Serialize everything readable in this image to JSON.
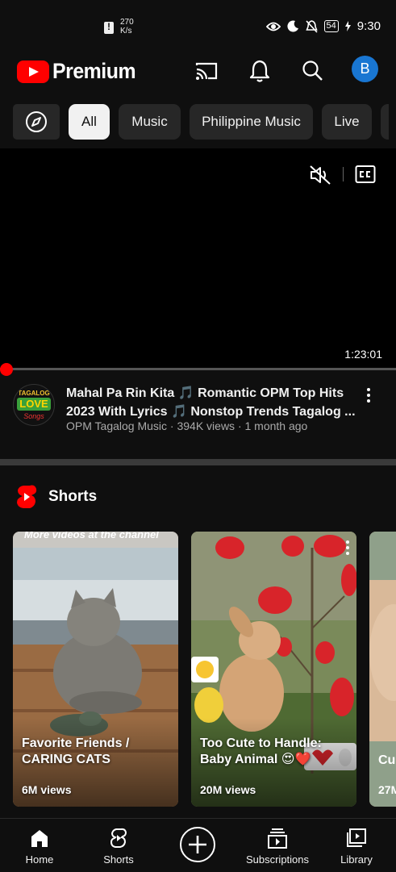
{
  "status_bar": {
    "net_speed_value": "270",
    "net_speed_unit": "K/s",
    "battery": "54",
    "time": "9:30"
  },
  "header": {
    "logo_text": "Premium",
    "avatar_letter": "B",
    "avatar_color": "#1976d2",
    "icons": [
      "cast-icon",
      "bell-icon",
      "search-icon"
    ]
  },
  "chips": [
    {
      "label": "All",
      "active": true
    },
    {
      "label": "Music"
    },
    {
      "label": "Philippine Music"
    },
    {
      "label": "Live"
    }
  ],
  "player": {
    "duration": "1:23:01",
    "progress": 0.0
  },
  "video": {
    "title": "Mahal Pa Rin Kita 🎵 Romantic OPM Top Hits 2023 With Lyrics 🎵 Nonstop Trends Tagalog ...",
    "meta": "OPM Tagalog Music · 394K views · 1 month ago",
    "channel_logo_lines": [
      "TAGALOG",
      "LOVE",
      "Songs"
    ]
  },
  "shorts": {
    "section_title": "Shorts",
    "items": [
      {
        "title": "Favorite Friends / CARING CATS",
        "views": "6M views",
        "overlay_text": "More videos at the channel"
      },
      {
        "title": "Too Cute to Handle: Baby Animal 😍❤️",
        "views": "20M views"
      },
      {
        "title": "Cu",
        "views": "27M"
      }
    ]
  },
  "bottom_nav": {
    "items": [
      {
        "label": "Home"
      },
      {
        "label": "Shorts"
      },
      {
        "label": ""
      },
      {
        "label": "Subscriptions"
      },
      {
        "label": "Library"
      }
    ]
  },
  "colors": {
    "background": "#0f0f0f",
    "brand_red": "#ff0000",
    "chip_bg": "#272727",
    "chip_active_bg": "#f1f1f1"
  }
}
